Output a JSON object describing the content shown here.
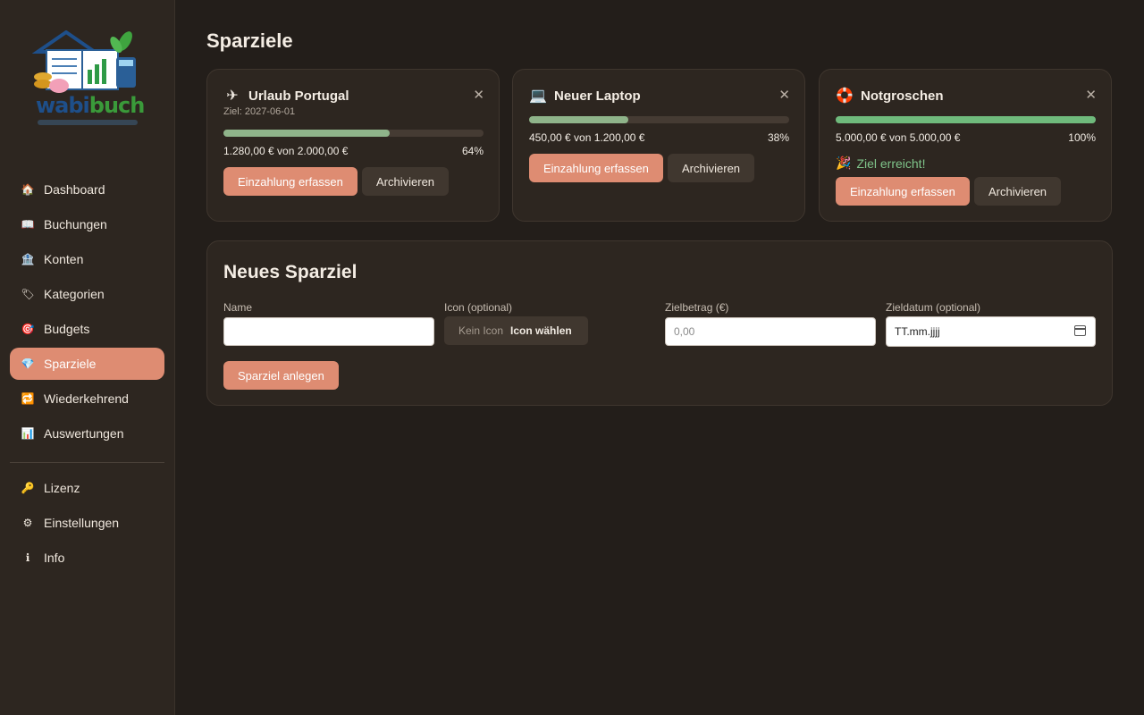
{
  "logo": {
    "word_left": "wabi",
    "word_right": "buch"
  },
  "nav": {
    "items": [
      {
        "label": "Dashboard",
        "icon": "house-icon",
        "glyph": "🏠",
        "active": false
      },
      {
        "label": "Buchungen",
        "icon": "book-icon",
        "glyph": "📖",
        "active": false
      },
      {
        "label": "Konten",
        "icon": "bank-icon",
        "glyph": "🏦",
        "active": false
      },
      {
        "label": "Kategorien",
        "icon": "tag-icon",
        "glyph": "🏷",
        "active": false
      },
      {
        "label": "Budgets",
        "icon": "target-icon",
        "glyph": "🎯",
        "active": false
      },
      {
        "label": "Sparziele",
        "icon": "gem-icon",
        "glyph": "💎",
        "active": true
      },
      {
        "label": "Wiederkehrend",
        "icon": "repeat-icon",
        "glyph": "🔁",
        "active": false
      },
      {
        "label": "Auswertungen",
        "icon": "bar-chart-icon",
        "glyph": "📊",
        "active": false
      }
    ],
    "secondary": [
      {
        "label": "Lizenz",
        "icon": "key-icon",
        "glyph": "🔑"
      },
      {
        "label": "Einstellungen",
        "icon": "gear-icon",
        "glyph": "⚙"
      },
      {
        "label": "Info",
        "icon": "info-icon",
        "glyph": "ℹ"
      }
    ]
  },
  "page": {
    "title": "Sparziele"
  },
  "goals": [
    {
      "name": "Urlaub Portugal",
      "icon": "airplane-icon",
      "glyph": "✈",
      "date_label": "Ziel: 2027-06-01",
      "amount_text": "1.280,00 € von 2.000,00 €",
      "percent_text": "64%",
      "progress": 0.64,
      "reached_text": "",
      "deposit_label": "Einzahlung erfassen",
      "archive_label": "Archivieren",
      "close_glyph": "✕"
    },
    {
      "name": "Neuer Laptop",
      "icon": "laptop-icon",
      "glyph": "💻",
      "date_label": "",
      "amount_text": "450,00 € von 1.200,00 €",
      "percent_text": "38%",
      "progress": 0.38,
      "reached_text": "",
      "deposit_label": "Einzahlung erfassen",
      "archive_label": "Archivieren",
      "close_glyph": "✕"
    },
    {
      "name": "Notgroschen",
      "icon": "lifebuoy-icon",
      "glyph": "🛟",
      "date_label": "",
      "amount_text": "5.000,00 € von 5.000,00 €",
      "percent_text": "100%",
      "progress": 1.0,
      "reached_text": "Ziel erreicht!",
      "reached_glyph": "🎉",
      "deposit_label": "Einzahlung erfassen",
      "archive_label": "Archivieren",
      "close_glyph": "✕"
    }
  ],
  "form": {
    "title": "Neues Sparziel",
    "name_label": "Name",
    "name_value": "",
    "icon_label": "Icon (optional)",
    "icon_none": "Kein Icon",
    "icon_choose": "Icon wählen",
    "amount_label": "Zielbetrag (€)",
    "amount_placeholder": "0,00",
    "date_label": "Zieldatum (optional)",
    "date_placeholder": "TT.mm.jjjj",
    "submit_label": "Sparziel anlegen"
  },
  "colors": {
    "accent": "#de8c72",
    "progress": "#8fb48a",
    "success": "#7fc48a",
    "background": "#231e1a",
    "surface": "#2d2620"
  }
}
